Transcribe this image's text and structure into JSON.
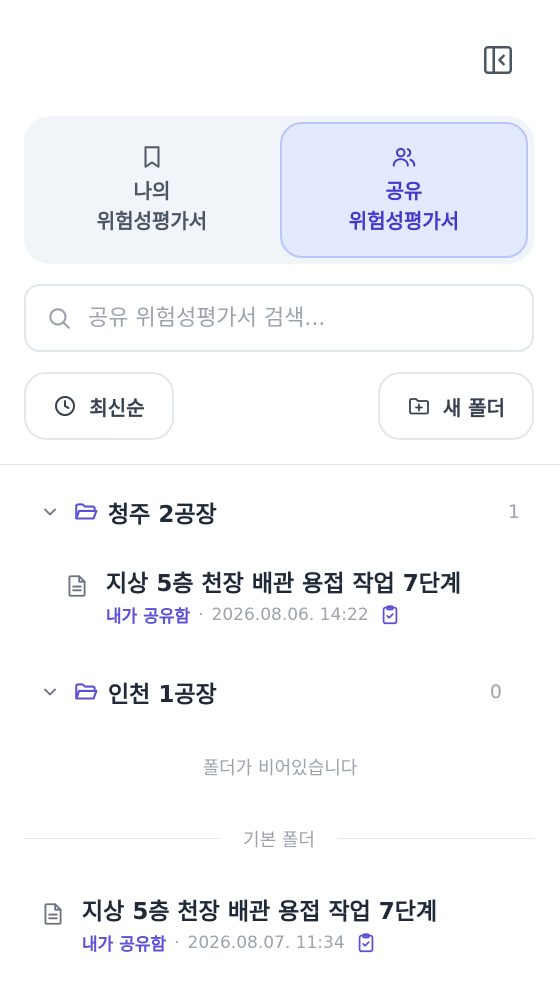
{
  "tabs": [
    {
      "line1": "나의",
      "line2": "위험성평가서",
      "icon": "bookmark-icon",
      "active": false
    },
    {
      "line1": "공유",
      "line2": "위험성평가서",
      "icon": "users-icon",
      "active": true
    }
  ],
  "search": {
    "placeholder": "공유 위험성평가서 검색..."
  },
  "toolbar": {
    "sort_label": "최신순",
    "new_folder_label": "새 폴더"
  },
  "folders": [
    {
      "name": "청주 2공장",
      "count": "1",
      "docs": [
        {
          "title": "지상 5층 천장 배관 용접 작업 7단계",
          "owner": "내가 공유함",
          "date": "2026.08.06. 14:22"
        }
      ]
    },
    {
      "name": "인천 1공장",
      "count": "0",
      "empty_message": "폴더가 비어있습니다"
    }
  ],
  "default_folder": {
    "label": "기본 폴더",
    "docs": [
      {
        "title": "지상 5층 천장 배관 용접 작업 7단계",
        "owner": "내가 공유함",
        "date": "2026.08.07. 11:34"
      }
    ]
  },
  "colors": {
    "accent": "#4338ca",
    "accent_light": "#e3e9ff",
    "muted": "#9ca3af"
  }
}
